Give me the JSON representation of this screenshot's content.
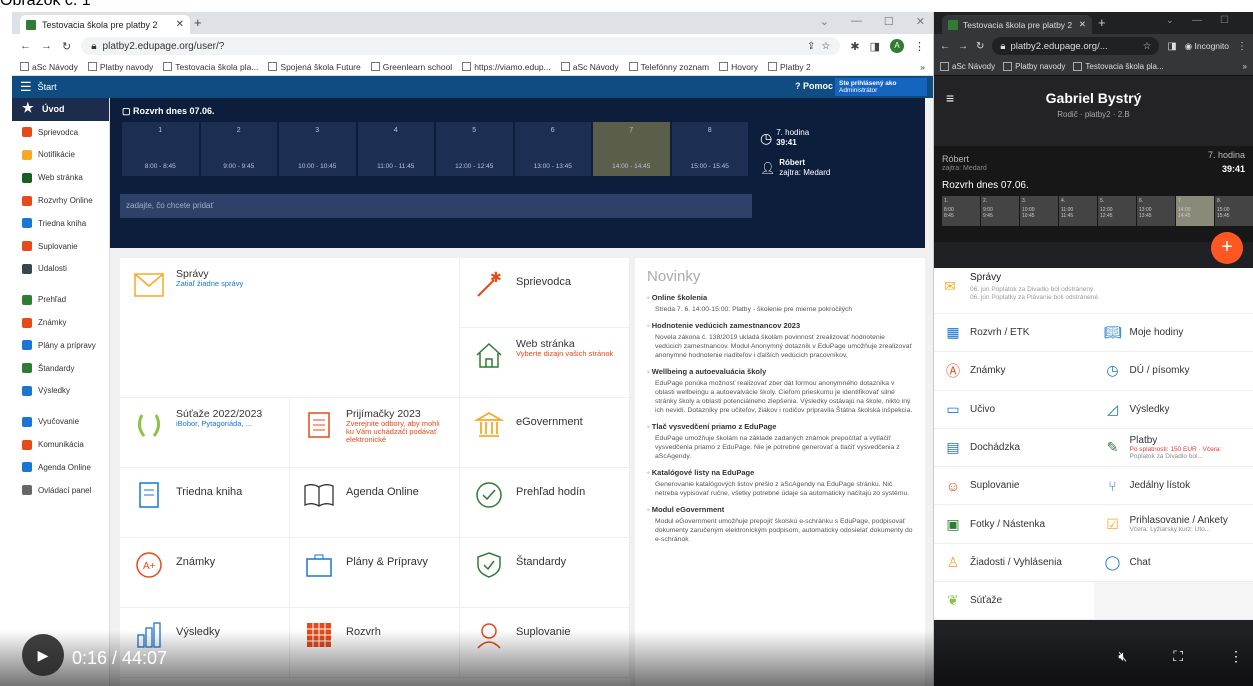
{
  "caption": "Obrázok č. 1",
  "left_browser": {
    "tab_title": "Testovacia škola pre platby 2",
    "address": "platby2.edupage.org/user/?",
    "profile_letter": "A",
    "bookmarks": [
      "aSc Návody",
      "Platby navody",
      "Testovacia škola pla...",
      "Spojená škola Future",
      "Greenlearn school",
      "https://viamo.edup...",
      "aSc Návody",
      "Telefónny zoznam",
      "Hovory",
      "Platby 2"
    ],
    "more_bookmarks": "»"
  },
  "app": {
    "start": "Štart",
    "pomoc": "Pomoc",
    "user_line1": "Ste prihlásený ako",
    "user_line2": "Administrátor"
  },
  "sidebar": {
    "items": [
      {
        "label": "Úvod",
        "icon": "star-icon",
        "color": "#ffffff"
      },
      {
        "label": "Sprievodca",
        "icon": "wand-icon",
        "color": "#e64a19"
      },
      {
        "label": "Notifikácie",
        "icon": "mail-icon",
        "color": "#f9a825"
      },
      {
        "label": "Web stránka",
        "icon": "home-icon",
        "color": "#1b5e20"
      },
      {
        "label": "Rozvrhy Online",
        "icon": "grid-icon",
        "color": "#e64a19"
      },
      {
        "label": "Triedna kniha",
        "icon": "book-icon",
        "color": "#1976d2"
      },
      {
        "label": "Suplovanie",
        "icon": "person-icon",
        "color": "#e64a19"
      },
      {
        "label": "Udalosti",
        "icon": "calendar-icon",
        "color": "#37474f"
      },
      {
        "label": "Prehľad",
        "icon": "check-icon",
        "color": "#2e7d32"
      },
      {
        "label": "Známky",
        "icon": "grade-icon",
        "color": "#e64a19"
      },
      {
        "label": "Plány a prípravy",
        "icon": "briefcase-icon",
        "color": "#1976d2"
      },
      {
        "label": "Štandardy",
        "icon": "shield-icon",
        "color": "#2e7d32"
      },
      {
        "label": "Výsledky",
        "icon": "bars-icon",
        "color": "#1976d2"
      },
      {
        "label": "Vyučovanie",
        "icon": "teacher-icon",
        "color": "#1976d2"
      },
      {
        "label": "Komunikácia",
        "icon": "chat-icon",
        "color": "#e64a19"
      },
      {
        "label": "Agenda Online",
        "icon": "pen-icon",
        "color": "#1976d2"
      },
      {
        "label": "Ovládací panel",
        "icon": "gear-icon",
        "color": "#666666"
      }
    ]
  },
  "rozvrh": {
    "title": "Rozvrh dnes 07.06.",
    "slots": [
      {
        "n": "1",
        "t": "8:00 - 8:45"
      },
      {
        "n": "2",
        "t": "9:00 - 9:45"
      },
      {
        "n": "3",
        "t": "10:00 - 10:45"
      },
      {
        "n": "4",
        "t": "11:00 - 11:45"
      },
      {
        "n": "5",
        "t": "12:00 - 12:45"
      },
      {
        "n": "6",
        "t": "13:00 - 13:45"
      },
      {
        "n": "7",
        "t": "14:00 - 14:45"
      },
      {
        "n": "8",
        "t": "15:00 - 15:45"
      }
    ],
    "current_slot": 7,
    "hodina": "7. hodina",
    "hodina_time": "39:41",
    "meniny_name": "Róbert",
    "meniny_next": "zajtra: Medard",
    "add_placeholder": "zadajte, čo chcete pridať"
  },
  "tiles": {
    "spravy": "Správy",
    "spravy_sub": "Zatiaľ žiadne správy",
    "sprievodca": "Sprievodca",
    "web": "Web stránka",
    "web_sub": "Vyberte dizajn vašich stránok",
    "sutaze": "Súťaže 2022/2023",
    "sutaze_sub": "iBobor, Pytagoriáda, ...",
    "prijimacky": "Prijímačky 2023",
    "prijimacky_sub": "Zverejnite odbory, aby mohli ku Vám uchádzači podávať elektronické",
    "egov": "eGovernment",
    "trieda": "Triedna kniha",
    "agenda": "Agenda Online",
    "prehlad": "Prehľad hodín",
    "znamky": "Známky",
    "plany": "Plány & Prípravy",
    "standardy": "Štandardy",
    "vysledky": "Výsledky",
    "rozvrh": "Rozvrh",
    "suplovanie": "Suplovanie"
  },
  "news": {
    "title": "Novinky",
    "items": [
      {
        "t": "Online školenia",
        "b": "Streda 7. 6. 14:00-15:00: Platby - školenie pre mierne pokročilých"
      },
      {
        "t": "Hodnotenie vedúcich zamestnancov 2023",
        "b": "Novela zákona č. 138/2019 ukladá školám povinnosť zrealizovať hodnotenie vedúcich zamestnancov. Modul Anonymný dotazník v EduPage umožňuje zrealizovať anonymné hodnotenie riaditeľov i ďalších vedúcich pracovníkov."
      },
      {
        "t": "Wellbeing a autoevaluácia školy",
        "b": "EduPage ponúka možnosť realizovať zber dát formou anonymného dotazníka v oblasti wellbeingu a autoevalvácie školy. Cieľom prieskumu je identifikovať silné stránky školy a oblasti potenciálneho zlepšenia. Výsledky ostávajú na škole, nikto iný ich nevidí. Dotazníky pre učiteľov, žiakov i rodičov pripravila Štátna školská inšpekcia."
      },
      {
        "t": "Tlač vysvedčení priamo z EduPage",
        "b": "EduPage umožňuje školám na základe zadaných známok prepočítať a vytlačiť vysvedčenia priamo z EduPage. Nie je potrebné generovať a tlačiť vysvedčenia z aScAgendy."
      },
      {
        "t": "Katalógové listy na EduPage",
        "b": "Generovanie katalógových listov prešlo z aScAgendy na EduPage stránku. Nič netreba vypisovať ručne, všetky potrebné údaje sa automaticky načítajú zo systému."
      },
      {
        "t": "Modul eGovernment",
        "b": "Modul eGovernment umožňuje prepojiť školskú e-schránku s EduPage, podpisovať dokumenty zaručeným elektronickým podpisom, automaticky odosielať dokumenty do e-schránok"
      }
    ]
  },
  "right_browser": {
    "tab_title": "Testovacia škola pre platby 2",
    "address": "platby2.edupage.org/...",
    "incognito": "Incognito",
    "bookmarks": [
      "aSc Návody",
      "Platby navody",
      "Testovacia škola pla..."
    ],
    "more_bookmarks": "»",
    "name": "Gabriel Bystrý",
    "sub": "Rodič · platby2 · 2.B",
    "meniny_name": "Róbert",
    "meniny_next": "zajtra: Medard",
    "hodina": "7. hodina",
    "hodina_time": "39:41",
    "rozvrh_title": "Rozvrh dnes 07.06.",
    "rslots": [
      {
        "n": "1.",
        "a": "8:00",
        "b": "8:45"
      },
      {
        "n": "2.",
        "a": "9:00",
        "b": "9:45"
      },
      {
        "n": "3.",
        "a": "10:00",
        "b": "10:45"
      },
      {
        "n": "4.",
        "a": "11:00",
        "b": "11:45"
      },
      {
        "n": "5.",
        "a": "12:00",
        "b": "12:45"
      },
      {
        "n": "6.",
        "a": "13:00",
        "b": "13:45"
      },
      {
        "n": "7.",
        "a": "14:00",
        "b": "14:45"
      },
      {
        "n": "8.",
        "a": "15:00",
        "b": "15:45"
      }
    ],
    "fab": "+",
    "spravy": "Správy",
    "spravy_l1_date": "06. jún",
    "spravy_l1": "Poplatok za Divadlo bol odstránený.",
    "spravy_l2_date": "06. jún",
    "spravy_l2": "Poplatky za Plávanie boli odstránené.",
    "grid": [
      [
        "Rozvrh / ETK",
        "Moje hodiny"
      ],
      [
        "Známky",
        "DÚ / písomky"
      ],
      [
        "Učivo",
        "Výsledky"
      ],
      [
        "Dochádzka",
        "Platby"
      ],
      [
        "Suplovanie",
        "Jedálny lístok"
      ],
      [
        "Fotky / Nástenka",
        "Prihlasovanie / Ankety"
      ],
      [
        "Žiadosti / Vyhlásenia",
        "Chat"
      ],
      [
        "Súťaže",
        ""
      ]
    ],
    "platby_sub1": "Po splatnosti: 150 EUR · Včera:",
    "platby_sub2": "Poplatok za Divadlo bol...",
    "ankety_sub": "Včera: Lyžiarsky kurz: Uto..."
  },
  "video": {
    "time": "0:16 / 44:07"
  }
}
